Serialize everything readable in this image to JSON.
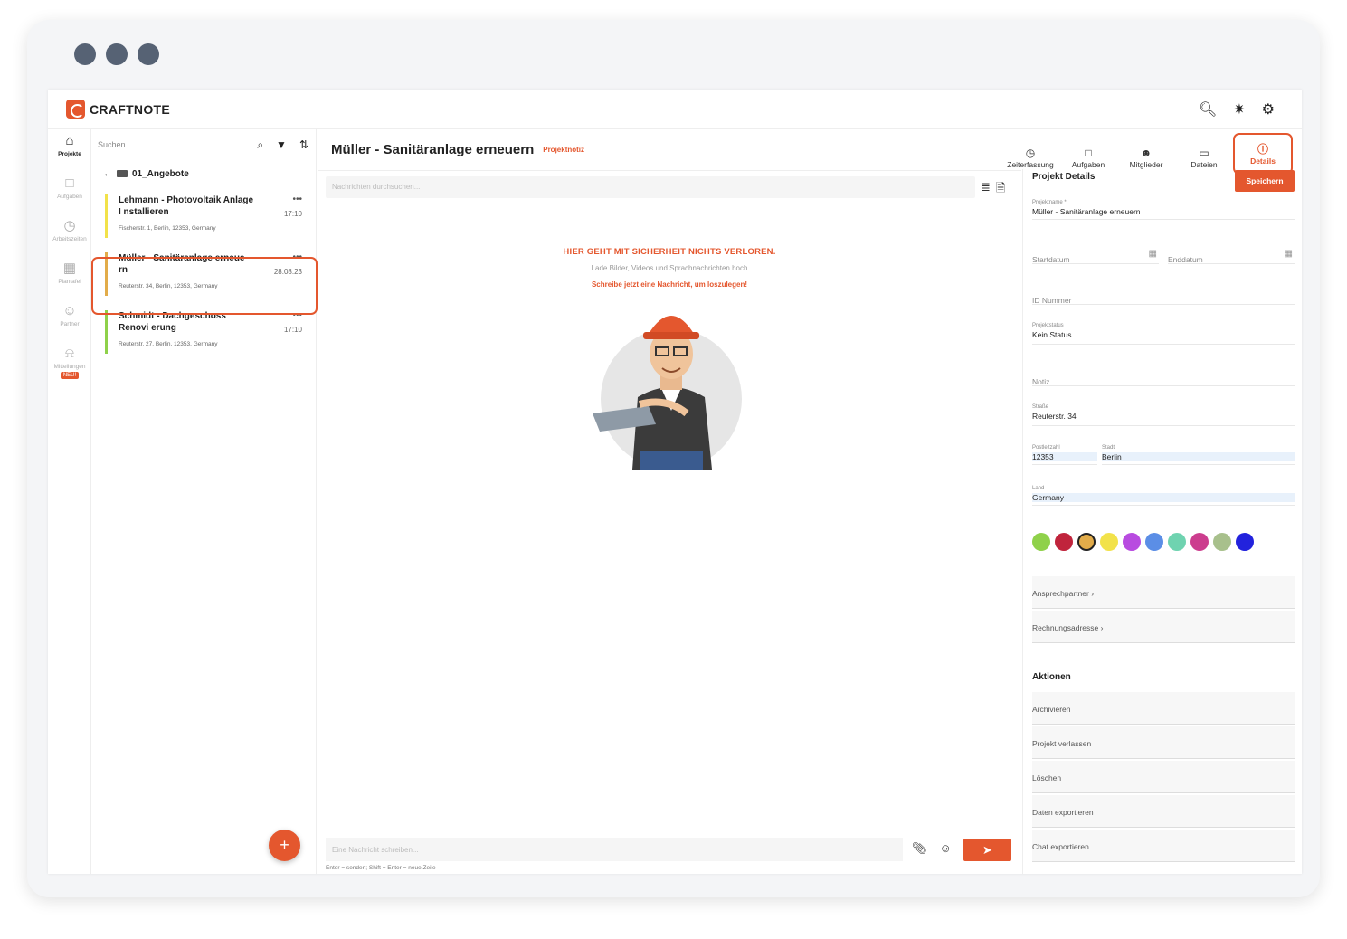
{
  "app": {
    "logo_text": "CRAFTNOTE"
  },
  "nav": [
    {
      "label": "Projekte",
      "icon": "home-icon"
    },
    {
      "label": "Aufgaben",
      "icon": "clipboard-icon"
    },
    {
      "label": "Arbeitszeiten",
      "icon": "clock-icon"
    },
    {
      "label": "Plantafel",
      "icon": "calendar-icon"
    },
    {
      "label": "Partner",
      "icon": "people-icon"
    },
    {
      "label": "Mitteilungen",
      "icon": "bell-icon",
      "badge": "NEU!"
    }
  ],
  "list": {
    "search_placeholder": "Suchen...",
    "folder": "01_Angebote",
    "projects": [
      {
        "name": "Lehmann - Photovoltaik Anlage I nstallieren",
        "time": "17:10",
        "address": "Fischerstr. 1, Berlin, 12353, Germany",
        "color": "#f2e24a"
      },
      {
        "name": "Müller - Sanitäranlage erneue rn",
        "time": "28.08.23",
        "address": "Reuterstr. 34, Berlin, 12353, Germany",
        "color": "#e2ac4a"
      },
      {
        "name": "Schmidt - Dachgeschoss Renovi erung",
        "time": "17:10",
        "address": "Reuterstr. 27, Berlin, 12353, Germany",
        "color": "#8fd14a"
      }
    ]
  },
  "chat": {
    "title": "Müller - Sanitäranlage erneuern",
    "tag": "Projektnotiz",
    "search_placeholder": "Nachrichten durchsuchen...",
    "empty_title": "HIER GEHT MIT SICHERHEIT NICHTS VERLOREN.",
    "empty_sub": "Lade Bilder, Videos und Sprachnachrichten hoch",
    "empty_cta": "Schreibe jetzt eine Nachricht, um loszulegen!",
    "composer_placeholder": "Eine Nachricht schreiben...",
    "hint": "Enter = senden; Shift + Enter = neue Zeile"
  },
  "tabs": [
    "Zeiterfassung",
    "Aufgaben",
    "Mitglieder",
    "Dateien",
    "Details"
  ],
  "panel": {
    "title": "Projekt Details",
    "save": "Speichern",
    "projektname_label": "Projektname *",
    "projektname": "Müller - Sanitäranlage erneuern",
    "start_ph": "Startdatum",
    "end_ph": "Enddatum",
    "id_ph": "ID Nummer",
    "status_label": "Projektstatus",
    "status": "Kein Status",
    "notiz_ph": "Notiz",
    "strasse_label": "Straße",
    "strasse": "Reuterstr. 34",
    "plz_label": "Postleitzahl",
    "plz": "12353",
    "stadt_label": "Stadt",
    "stadt": "Berlin",
    "land_label": "Land",
    "land": "Germany",
    "swatches": [
      "#8fd14a",
      "#c0243c",
      "#e2ac4a",
      "#f2e24a",
      "#b84be0",
      "#5b8ee6",
      "#6fd3b0",
      "#cc3d8e",
      "#a8c08c",
      "#2222dd"
    ],
    "ansprechpartner": "Ansprechpartner",
    "rechnungsadresse": "Rechnungsadresse",
    "aktionen": "Aktionen",
    "actions": [
      "Archivieren",
      "Projekt verlassen",
      "Löschen",
      "Daten exportieren",
      "Chat exportieren"
    ]
  }
}
